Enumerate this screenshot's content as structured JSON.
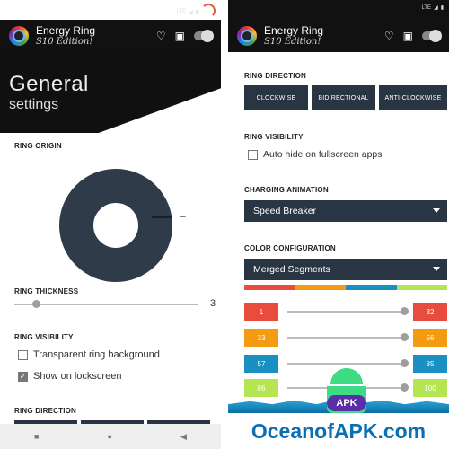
{
  "app": {
    "title": "Energy Ring",
    "subtitle": "S10 Edition!",
    "status_network": "LTE"
  },
  "left": {
    "hero_title": "General",
    "hero_subtitle": "settings",
    "ring_origin_title": "RING ORIGIN",
    "ring_origin_marker": "–",
    "ring_thickness_title": "RING THICKNESS",
    "ring_thickness_value": "3",
    "ring_thickness_level": 0.12,
    "ring_visibility_title": "RING VISIBILITY",
    "checkboxes": [
      {
        "label": "Transparent ring background",
        "checked": false
      },
      {
        "label": "Show on lockscreen",
        "checked": true
      }
    ],
    "ring_direction_title": "RING DIRECTION"
  },
  "right": {
    "ring_direction_title": "RING DIRECTION",
    "direction_buttons": [
      "CLOCKWISE",
      "BIDIRECTIONAL",
      "ANTI-CLOCKWISE"
    ],
    "ring_visibility_title": "RING VISIBILITY",
    "auto_hide_label": "Auto hide on fullscreen apps",
    "auto_hide_checked": false,
    "charging_title": "CHARGING ANIMATION",
    "charging_value": "Speed Breaker",
    "color_title": "COLOR CONFIGURATION",
    "color_value": "Merged Segments",
    "color_bar": [
      "#e74c3c",
      "#f39c12",
      "#1a8fc2",
      "#b5e550"
    ],
    "segments": [
      {
        "from": "1",
        "to": "32",
        "color": "#e74c3c"
      },
      {
        "from": "33",
        "to": "56",
        "color": "#f39c12"
      },
      {
        "from": "57",
        "to": "85",
        "color": "#1a8fc2"
      },
      {
        "from": "86",
        "to": "100",
        "color": "#b5e550"
      }
    ]
  },
  "navbar": [
    "■",
    "●",
    "◀"
  ],
  "watermark": {
    "badge": "APK",
    "text": "OceanofAPK.com"
  },
  "colors": {
    "appbar": "#111111",
    "control": "#2a3543",
    "donut": "#2f3b48"
  }
}
